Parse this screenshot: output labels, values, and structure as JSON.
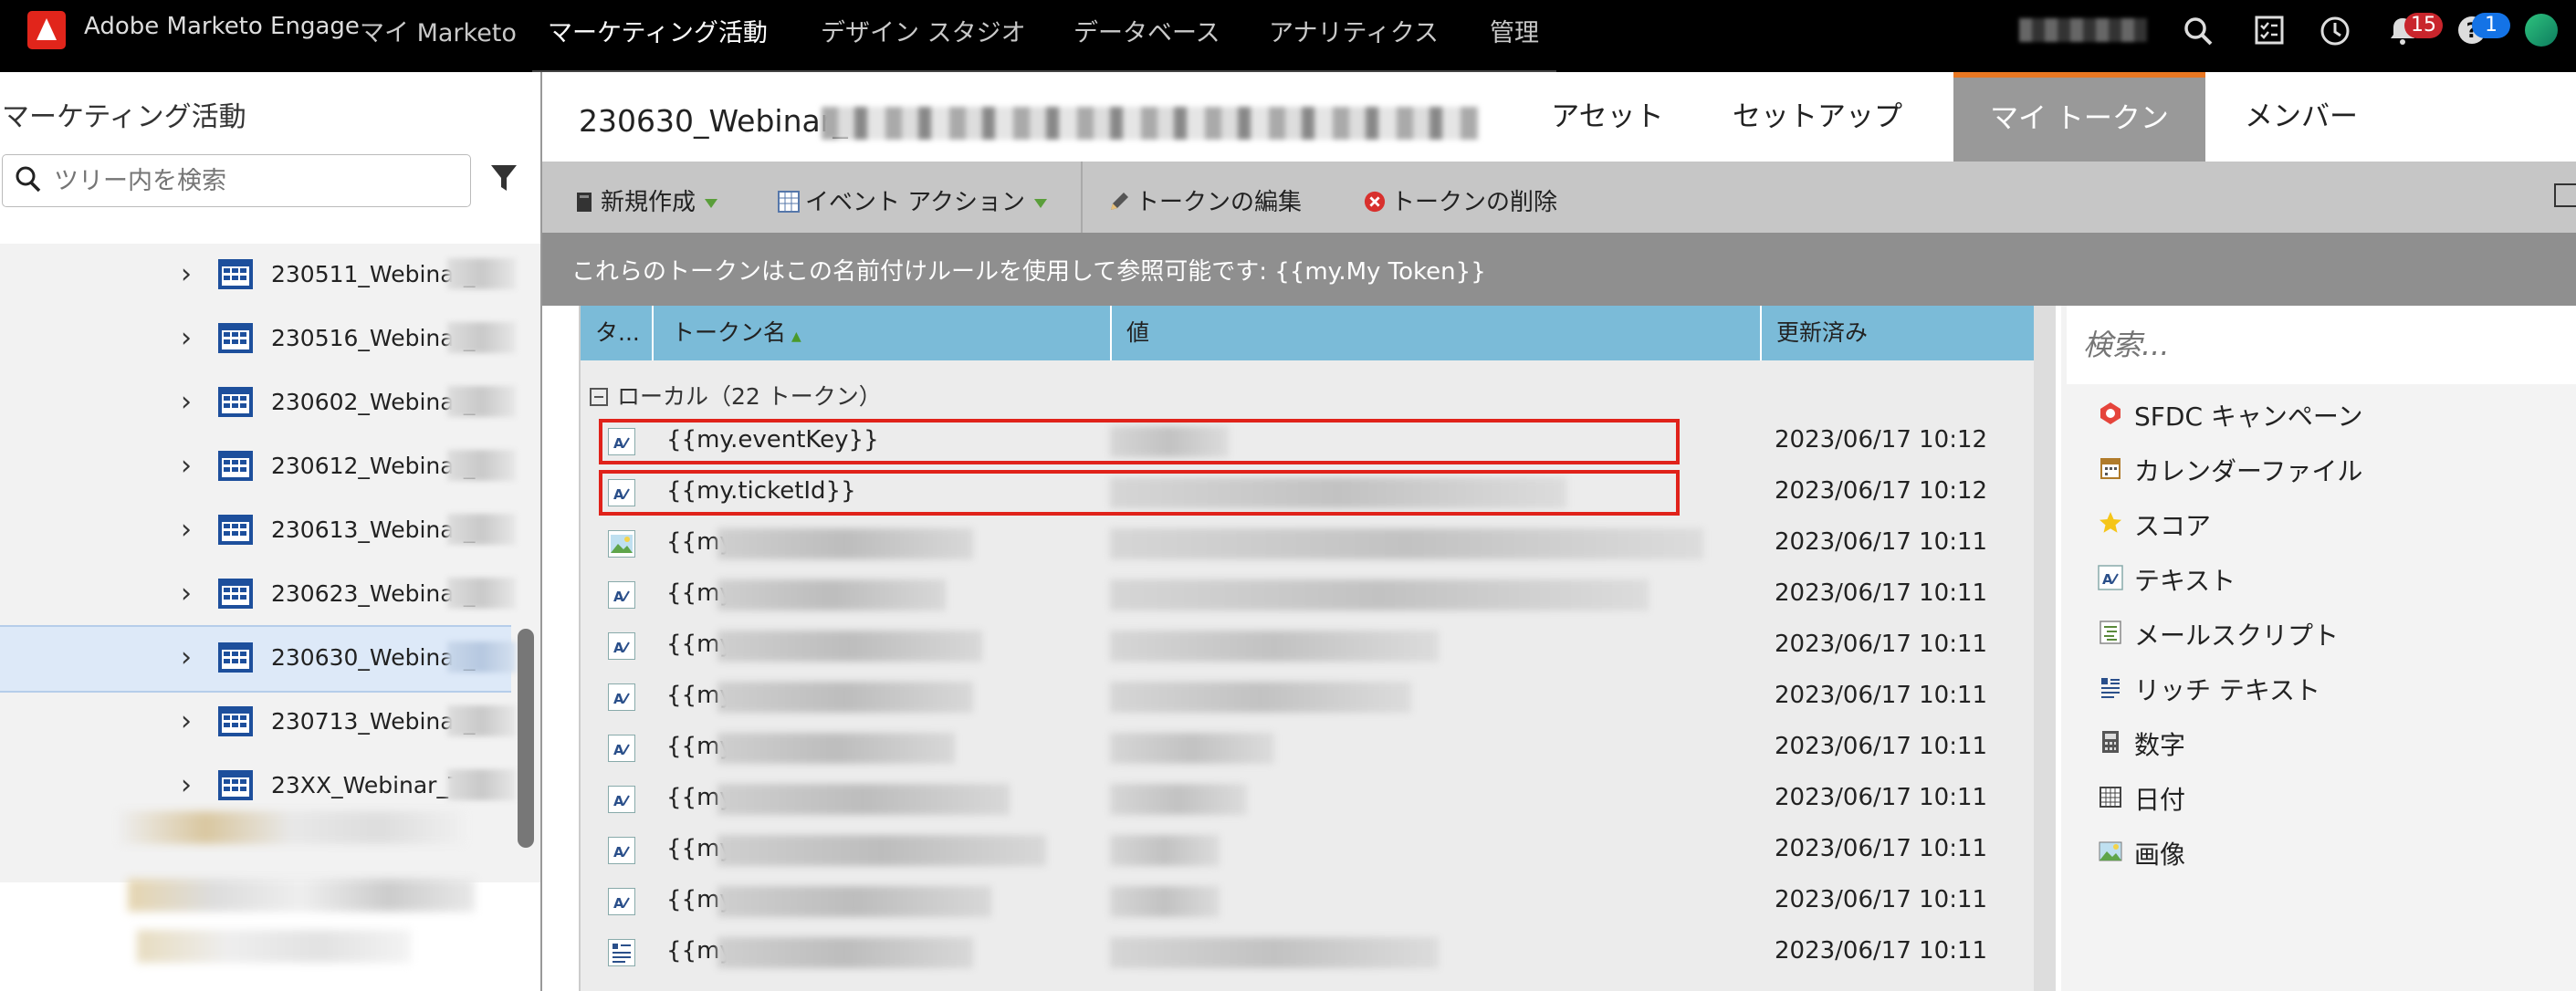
{
  "topnav": {
    "brand": "Adobe Marketo Engage",
    "items": [
      "マイ Marketo",
      "マーケティング活動",
      "デザイン スタジオ",
      "データベース",
      "アナリティクス",
      "管理"
    ],
    "active_index": 1,
    "notifications_count": "15",
    "help_count": "1"
  },
  "sidebar": {
    "title": "マーケティング活動",
    "search_placeholder": "ツリー内を検索",
    "items": [
      {
        "label": "230511_Webinar_"
      },
      {
        "label": "230516_Webinar_"
      },
      {
        "label": "230602_Webinar_"
      },
      {
        "label": "230612_Webinar_"
      },
      {
        "label": "230613_Webinar_"
      },
      {
        "label": "230623_Webinar_"
      },
      {
        "label": "230630_Webinar_"
      },
      {
        "label": "230713_Webinar_"
      },
      {
        "label": "23XX_Webinar_T"
      }
    ],
    "selected_index": 6
  },
  "main": {
    "program_title": "230630_Webinar_",
    "tabs": [
      "アセット",
      "セットアップ",
      "マイ トークン",
      "メンバー"
    ],
    "active_tab": 2,
    "toolbar": {
      "new": "新規作成",
      "event_action": "イベント アクション",
      "edit_token": "トークンの編集",
      "delete_token": "トークンの削除"
    },
    "info_text": "これらのトークンはこの名前付けルールを使用して参照可能です: {{my.My Token}}",
    "grid": {
      "columns": [
        "タ...",
        "トークン名",
        "値",
        "更新済み"
      ],
      "group_label": "ローカル（22 トークン）",
      "rows": [
        {
          "name": "{{my.eventKey}}",
          "updated": "2023/06/17 10:12",
          "icon": "text-token-icon"
        },
        {
          "name": "{{my.ticketId}}",
          "updated": "2023/06/17 10:12",
          "icon": "text-token-icon"
        },
        {
          "name": "{{my.",
          "updated": "2023/06/17 10:11",
          "icon": "image-token-icon"
        },
        {
          "name": "{{my.",
          "updated": "2023/06/17 10:11",
          "icon": "text-token-icon"
        },
        {
          "name": "{{my.",
          "updated": "2023/06/17 10:11",
          "icon": "text-token-icon"
        },
        {
          "name": "{{my.",
          "updated": "2023/06/17 10:11",
          "icon": "text-token-icon"
        },
        {
          "name": "{{my.",
          "updated": "2023/06/17 10:11",
          "icon": "text-token-icon"
        },
        {
          "name": "{{my.",
          "updated": "2023/06/17 10:11",
          "icon": "text-token-icon"
        },
        {
          "name": "{{my.",
          "updated": "2023/06/17 10:11",
          "icon": "text-token-icon"
        },
        {
          "name": "{{my.",
          "updated": "2023/06/17 10:11",
          "icon": "text-token-icon"
        },
        {
          "name": "{{my.",
          "updated": "2023/06/17 10:11",
          "icon": "rich-text-token-icon"
        }
      ]
    }
  },
  "palette": {
    "search_placeholder": "検索...",
    "items": [
      {
        "label": "SFDC キャンペーン",
        "icon": "sfdc-campaign-icon"
      },
      {
        "label": "カレンダーファイル",
        "icon": "calendar-file-icon"
      },
      {
        "label": "スコア",
        "icon": "star-icon"
      },
      {
        "label": "テキスト",
        "icon": "text-icon"
      },
      {
        "label": "メールスクリプト",
        "icon": "email-script-icon"
      },
      {
        "label": "リッチ テキスト",
        "icon": "rich-text-icon"
      },
      {
        "label": "数字",
        "icon": "number-icon"
      },
      {
        "label": "日付",
        "icon": "date-icon"
      },
      {
        "label": "画像",
        "icon": "image-icon"
      }
    ]
  },
  "colors": {
    "accent_orange": "#e87722",
    "highlight_red": "#e0221a",
    "grid_header": "#7bbbd8",
    "adobe_red": "#e1251b"
  }
}
